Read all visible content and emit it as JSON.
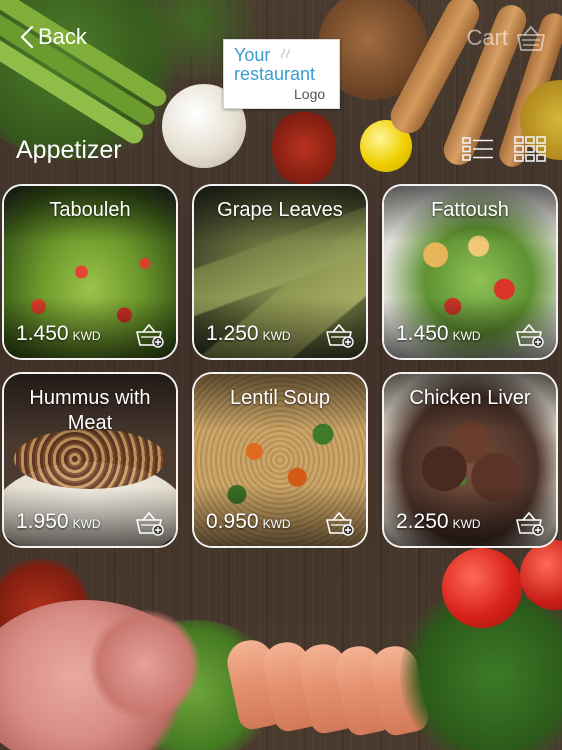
{
  "nav": {
    "back_label": "Back",
    "cart_label": "Cart"
  },
  "logo": {
    "line1": "Your",
    "line2": "restaurant",
    "line3": "Logo"
  },
  "section": {
    "title": "Appetizer"
  },
  "products": [
    {
      "name": "Tabouleh",
      "price": "1.450",
      "currency": "KWD"
    },
    {
      "name": "Grape Leaves",
      "price": "1.250",
      "currency": "KWD"
    },
    {
      "name": "Fattoush",
      "price": "1.450",
      "currency": "KWD"
    },
    {
      "name": "Hummus with Meat",
      "price": "1.950",
      "currency": "KWD"
    },
    {
      "name": "Lentil Soup",
      "price": "0.950",
      "currency": "KWD"
    },
    {
      "name": "Chicken Liver",
      "price": "2.250",
      "currency": "KWD"
    }
  ],
  "icons": {
    "back": "chevron-left-icon",
    "cart": "basket-icon",
    "list_view": "list-view-icon",
    "grid_view": "grid-view-icon",
    "add_to_cart": "basket-plus-icon"
  },
  "colors": {
    "logo_text": "#3b9cd0",
    "card_border": "#f2f2f2",
    "cart_dim": "rgba(255,255,255,0.55)"
  }
}
